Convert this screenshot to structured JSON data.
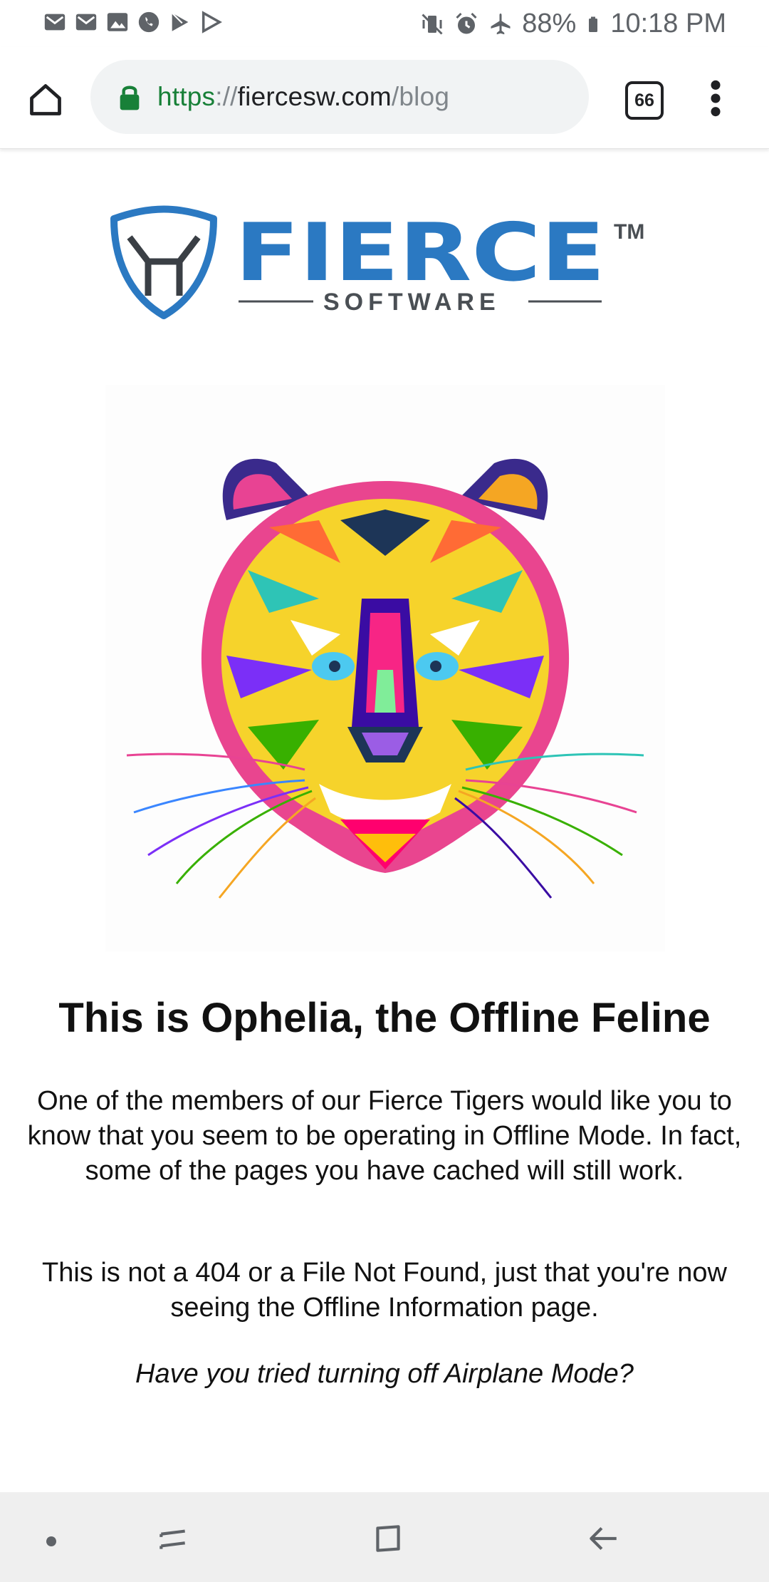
{
  "status_bar": {
    "battery": "88%",
    "time": "10:18 PM",
    "left_icons": [
      "gmail-icon",
      "gmail-icon",
      "gallery-icon",
      "phone-icon",
      "play-store-icon",
      "play-store-icon"
    ],
    "right_icons": [
      "vibrate-mute-icon",
      "alarm-icon",
      "airplane-icon",
      "battery-icon"
    ]
  },
  "browser": {
    "url": {
      "scheme": "https",
      "separator": "://",
      "host": "fiercesw.com",
      "path": "/blog"
    },
    "tab_count": "66",
    "colors": {
      "secure_green": "#188038",
      "url_bar_bg": "#f1f3f4"
    }
  },
  "page": {
    "logo": {
      "brand": "FIERCE",
      "tagline": "SOFTWARE",
      "trademark": "TM",
      "colors": {
        "blue": "#2b79c2",
        "dark_blue": "#1f5ea8",
        "gray": "#4a4f54"
      }
    },
    "heading": "This is Ophelia, the Offline Feline",
    "paragraph_1": "One of the members of our Fierce Tigers would like you to know that you seem to be operating in Offline Mode. In fact, some of the pages you have cached will still work.",
    "paragraph_2": "This is not a 404 or a File Not Found, just that you're now seeing the Offline Information page.",
    "paragraph_3": "Have you tried turning off Airplane Mode?"
  },
  "nav_bar": {
    "buttons": [
      "dot-icon",
      "recents-icon",
      "home-icon",
      "back-icon"
    ]
  }
}
